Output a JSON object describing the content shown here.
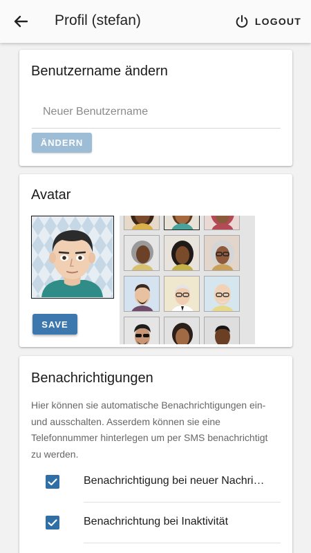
{
  "appbar": {
    "title": "Profil (stefan)",
    "logout_label": "LOGOUT",
    "back_icon": "arrow-back-icon",
    "logout_icon": "power-icon"
  },
  "username_card": {
    "title": "Benutzername ändern",
    "input_placeholder": "Neuer Benutzername",
    "input_value": "",
    "button_label": "ÄNDERN"
  },
  "avatar_card": {
    "title": "Avatar",
    "save_label": "SAVE",
    "current_avatar": "avatar-young-man",
    "choices": [
      {
        "name": "avatar-woman-dark-curly"
      },
      {
        "name": "avatar-woman-brown-hair"
      },
      {
        "name": "avatar-woman-headscarf"
      },
      {
        "name": "avatar-woman-gray-hair"
      },
      {
        "name": "avatar-woman-dark-hair"
      },
      {
        "name": "avatar-woman-glasses-white-hair"
      },
      {
        "name": "avatar-man-beard"
      },
      {
        "name": "avatar-man-glasses-white-hair"
      },
      {
        "name": "avatar-man-bald-glasses"
      },
      {
        "name": "avatar-man-sunglasses"
      },
      {
        "name": "avatar-woman-dark-bun"
      },
      {
        "name": "avatar-man-dark"
      }
    ]
  },
  "notifications_card": {
    "title": "Benachrichtigungen",
    "description": "Hier können sie automatische Benachrichtigungen ein- und ausschalten. Asserdem können sie eine Telefonnummer hinterlegen um per SMS benachrichtigt zu werden.",
    "items": [
      {
        "label": "Benachrichtigung bei neuer Nachricht",
        "checked": true
      },
      {
        "label": "Benachrichtung bei Inaktivität",
        "checked": true
      }
    ]
  },
  "colors": {
    "primary": "#3c78ae",
    "primary_disabled": "#9dbdd7",
    "checkbox": "#2f6fa5"
  }
}
